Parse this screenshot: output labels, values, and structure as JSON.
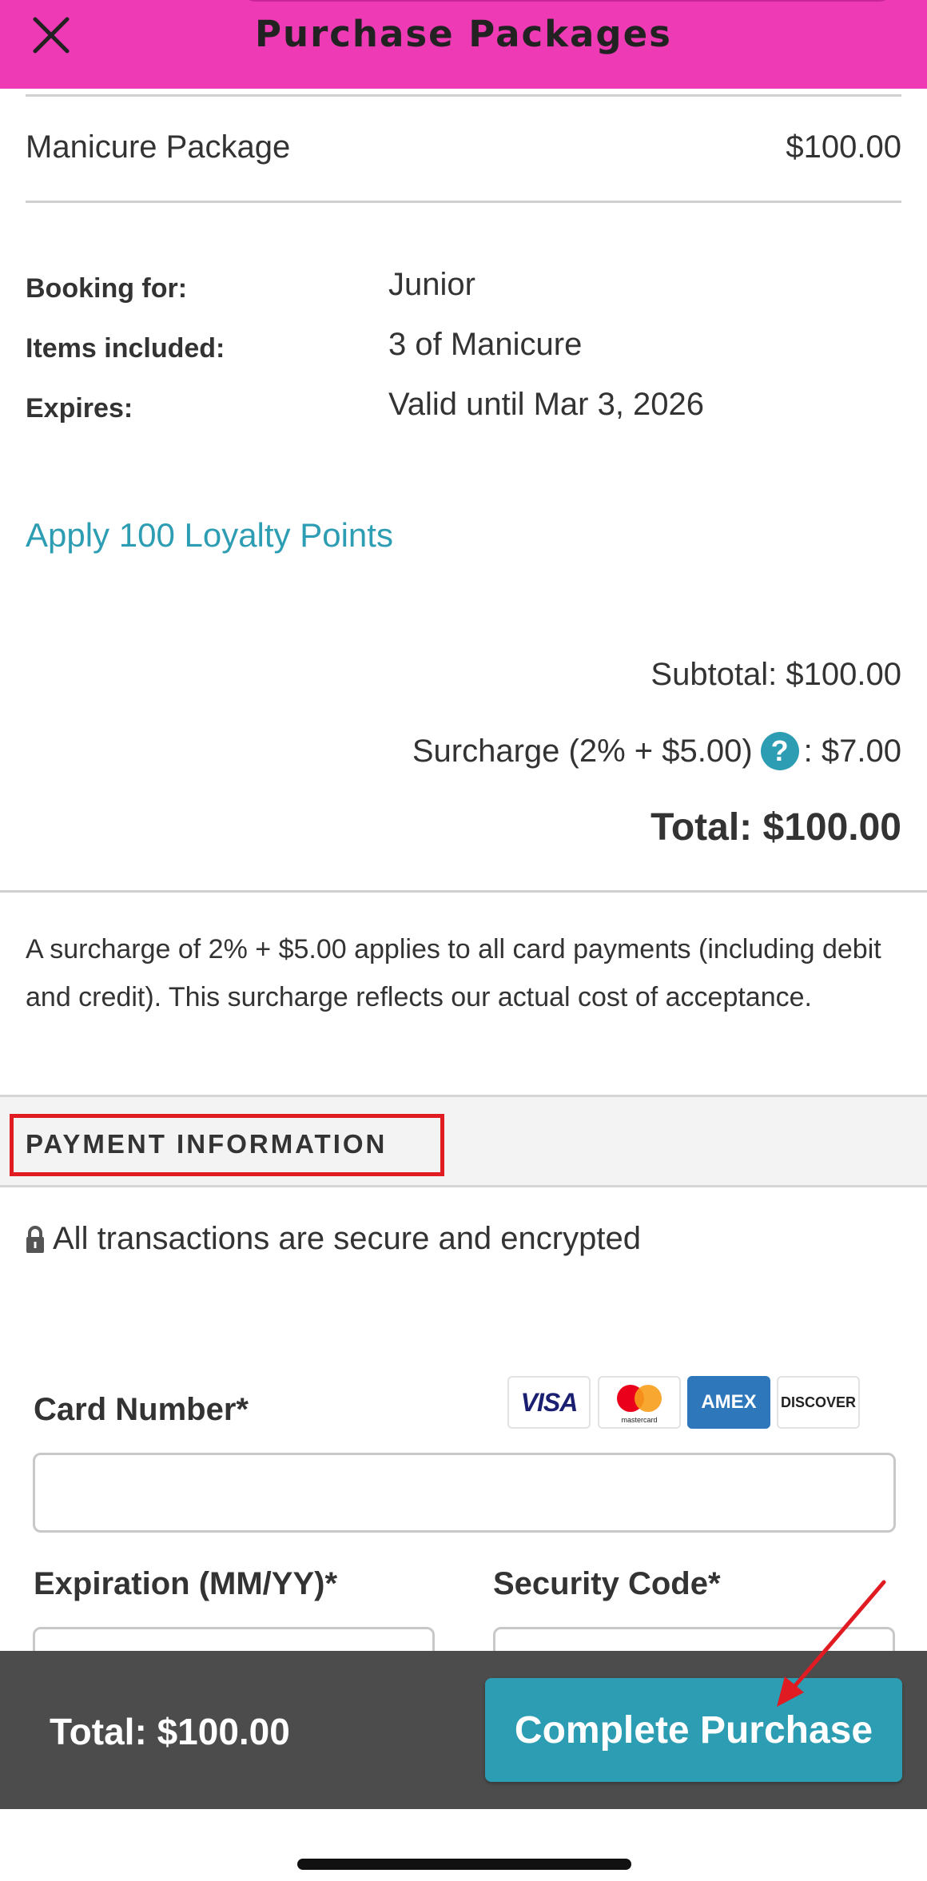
{
  "header": {
    "title": "Purchase Packages",
    "close_icon": "close-icon",
    "background_color": "#ee3bb5"
  },
  "package": {
    "name": "Manicure Package",
    "price": "$100.00"
  },
  "details": [
    {
      "label": "Booking for:",
      "value": "Junior"
    },
    {
      "label": "Items included:",
      "value": "3 of Manicure"
    },
    {
      "label": "Expires:",
      "value": "Valid until Mar 3, 2026"
    }
  ],
  "loyalty_link": "Apply 100 Loyalty Points",
  "summary": {
    "subtotal": "Subtotal: $100.00",
    "surcharge_label": "Surcharge (2% + $5.00)",
    "help_icon_glyph": "?",
    "surcharge_value": ": $7.00",
    "total": "Total: $100.00"
  },
  "notice": "A surcharge of 2% + $5.00 applies to all card payments (including debit and credit). This surcharge reflects our actual cost of acceptance.",
  "payment": {
    "heading": "PAYMENT INFORMATION",
    "secure_text": "All transactions are secure and encrypted",
    "card_number_label": "Card Number*",
    "card_number_value": "",
    "expiration_label": "Expiration (MM/YY)*",
    "expiration_value": "",
    "security_code_label": "Security Code*",
    "security_code_value": "",
    "card_brands": [
      "VISA",
      "mastercard",
      "AMEX",
      "DISCOVER"
    ]
  },
  "bottom_bar": {
    "total": "Total: $100.00",
    "button_label": "Complete Purchase"
  },
  "colors": {
    "accent": "#2c9db3",
    "annotation_red": "#e01b22",
    "bar": "#4c4c4c"
  }
}
